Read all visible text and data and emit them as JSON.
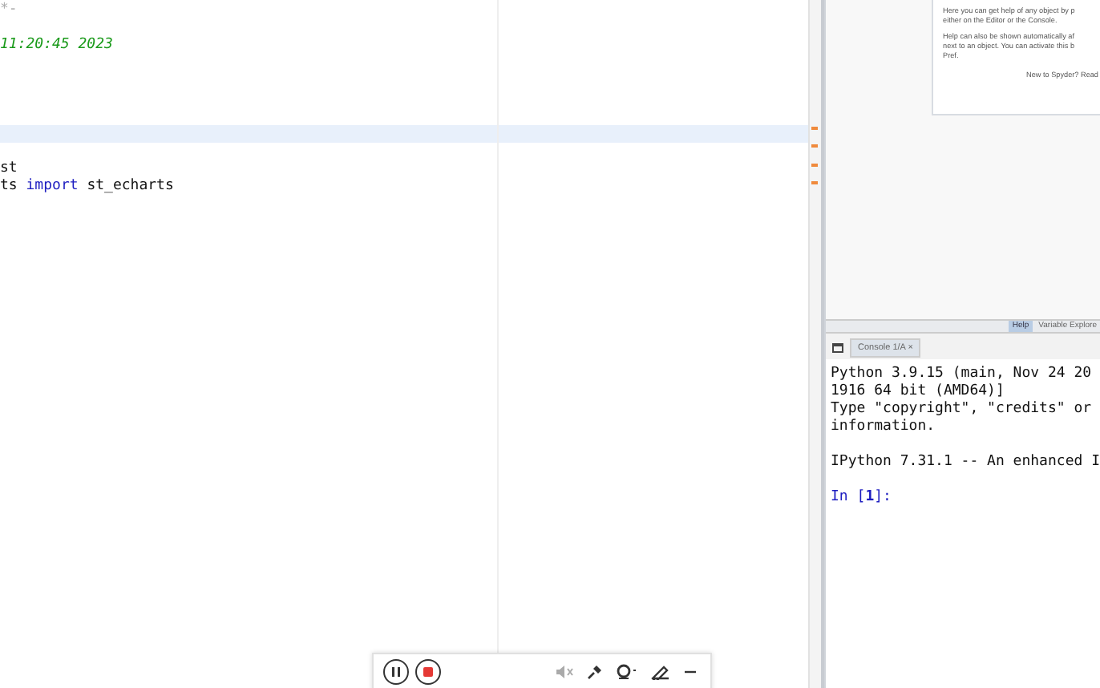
{
  "editor": {
    "lines": [
      {
        "kind": "code",
        "segments": [
          {
            "kind": "comment",
            "text": "*-"
          }
        ]
      },
      {
        "kind": "blank"
      },
      {
        "kind": "code",
        "segments": [
          {
            "kind": "docstring",
            "text": "11:20:45 2023"
          }
        ]
      },
      {
        "kind": "blank"
      },
      {
        "kind": "blank"
      },
      {
        "kind": "blank"
      },
      {
        "kind": "blank"
      },
      {
        "kind": "current"
      },
      {
        "kind": "blank"
      },
      {
        "kind": "code",
        "segments": [
          {
            "kind": "plain",
            "text": "st"
          }
        ]
      },
      {
        "kind": "code",
        "segments": [
          {
            "kind": "plain",
            "text": "ts "
          },
          {
            "kind": "keyword",
            "text": "import"
          },
          {
            "kind": "plain",
            "text": " st_echarts"
          }
        ]
      }
    ]
  },
  "help": {
    "paragraphs": [
      "Here you can get help of any object by p",
      "either on the Editor or the Console.",
      "Help can also be shown automatically af",
      "next to an object. You can activate this b",
      "Pref."
    ],
    "footer": "New to Spyder? Read",
    "tabs": [
      {
        "label": "Help",
        "selected": true
      },
      {
        "label": "Variable Explore",
        "selected": false
      }
    ]
  },
  "console": {
    "tabs": [
      {
        "label": "Console 1/A",
        "close": "×",
        "selected": true
      }
    ],
    "lines": [
      {
        "kind": "output",
        "text": "Python 3.9.15 (main, Nov 24 20"
      },
      {
        "kind": "output",
        "text": "1916 64 bit (AMD64)]"
      },
      {
        "kind": "output",
        "text": "Type \"copyright\", \"credits\" or"
      },
      {
        "kind": "output",
        "text": "information."
      },
      {
        "kind": "blank"
      },
      {
        "kind": "output",
        "text": "IPython 7.31.1 -- An enhanced I"
      },
      {
        "kind": "blank"
      },
      {
        "kind": "prompt",
        "text": "In [",
        "num": "1",
        "end": "]:"
      }
    ]
  }
}
